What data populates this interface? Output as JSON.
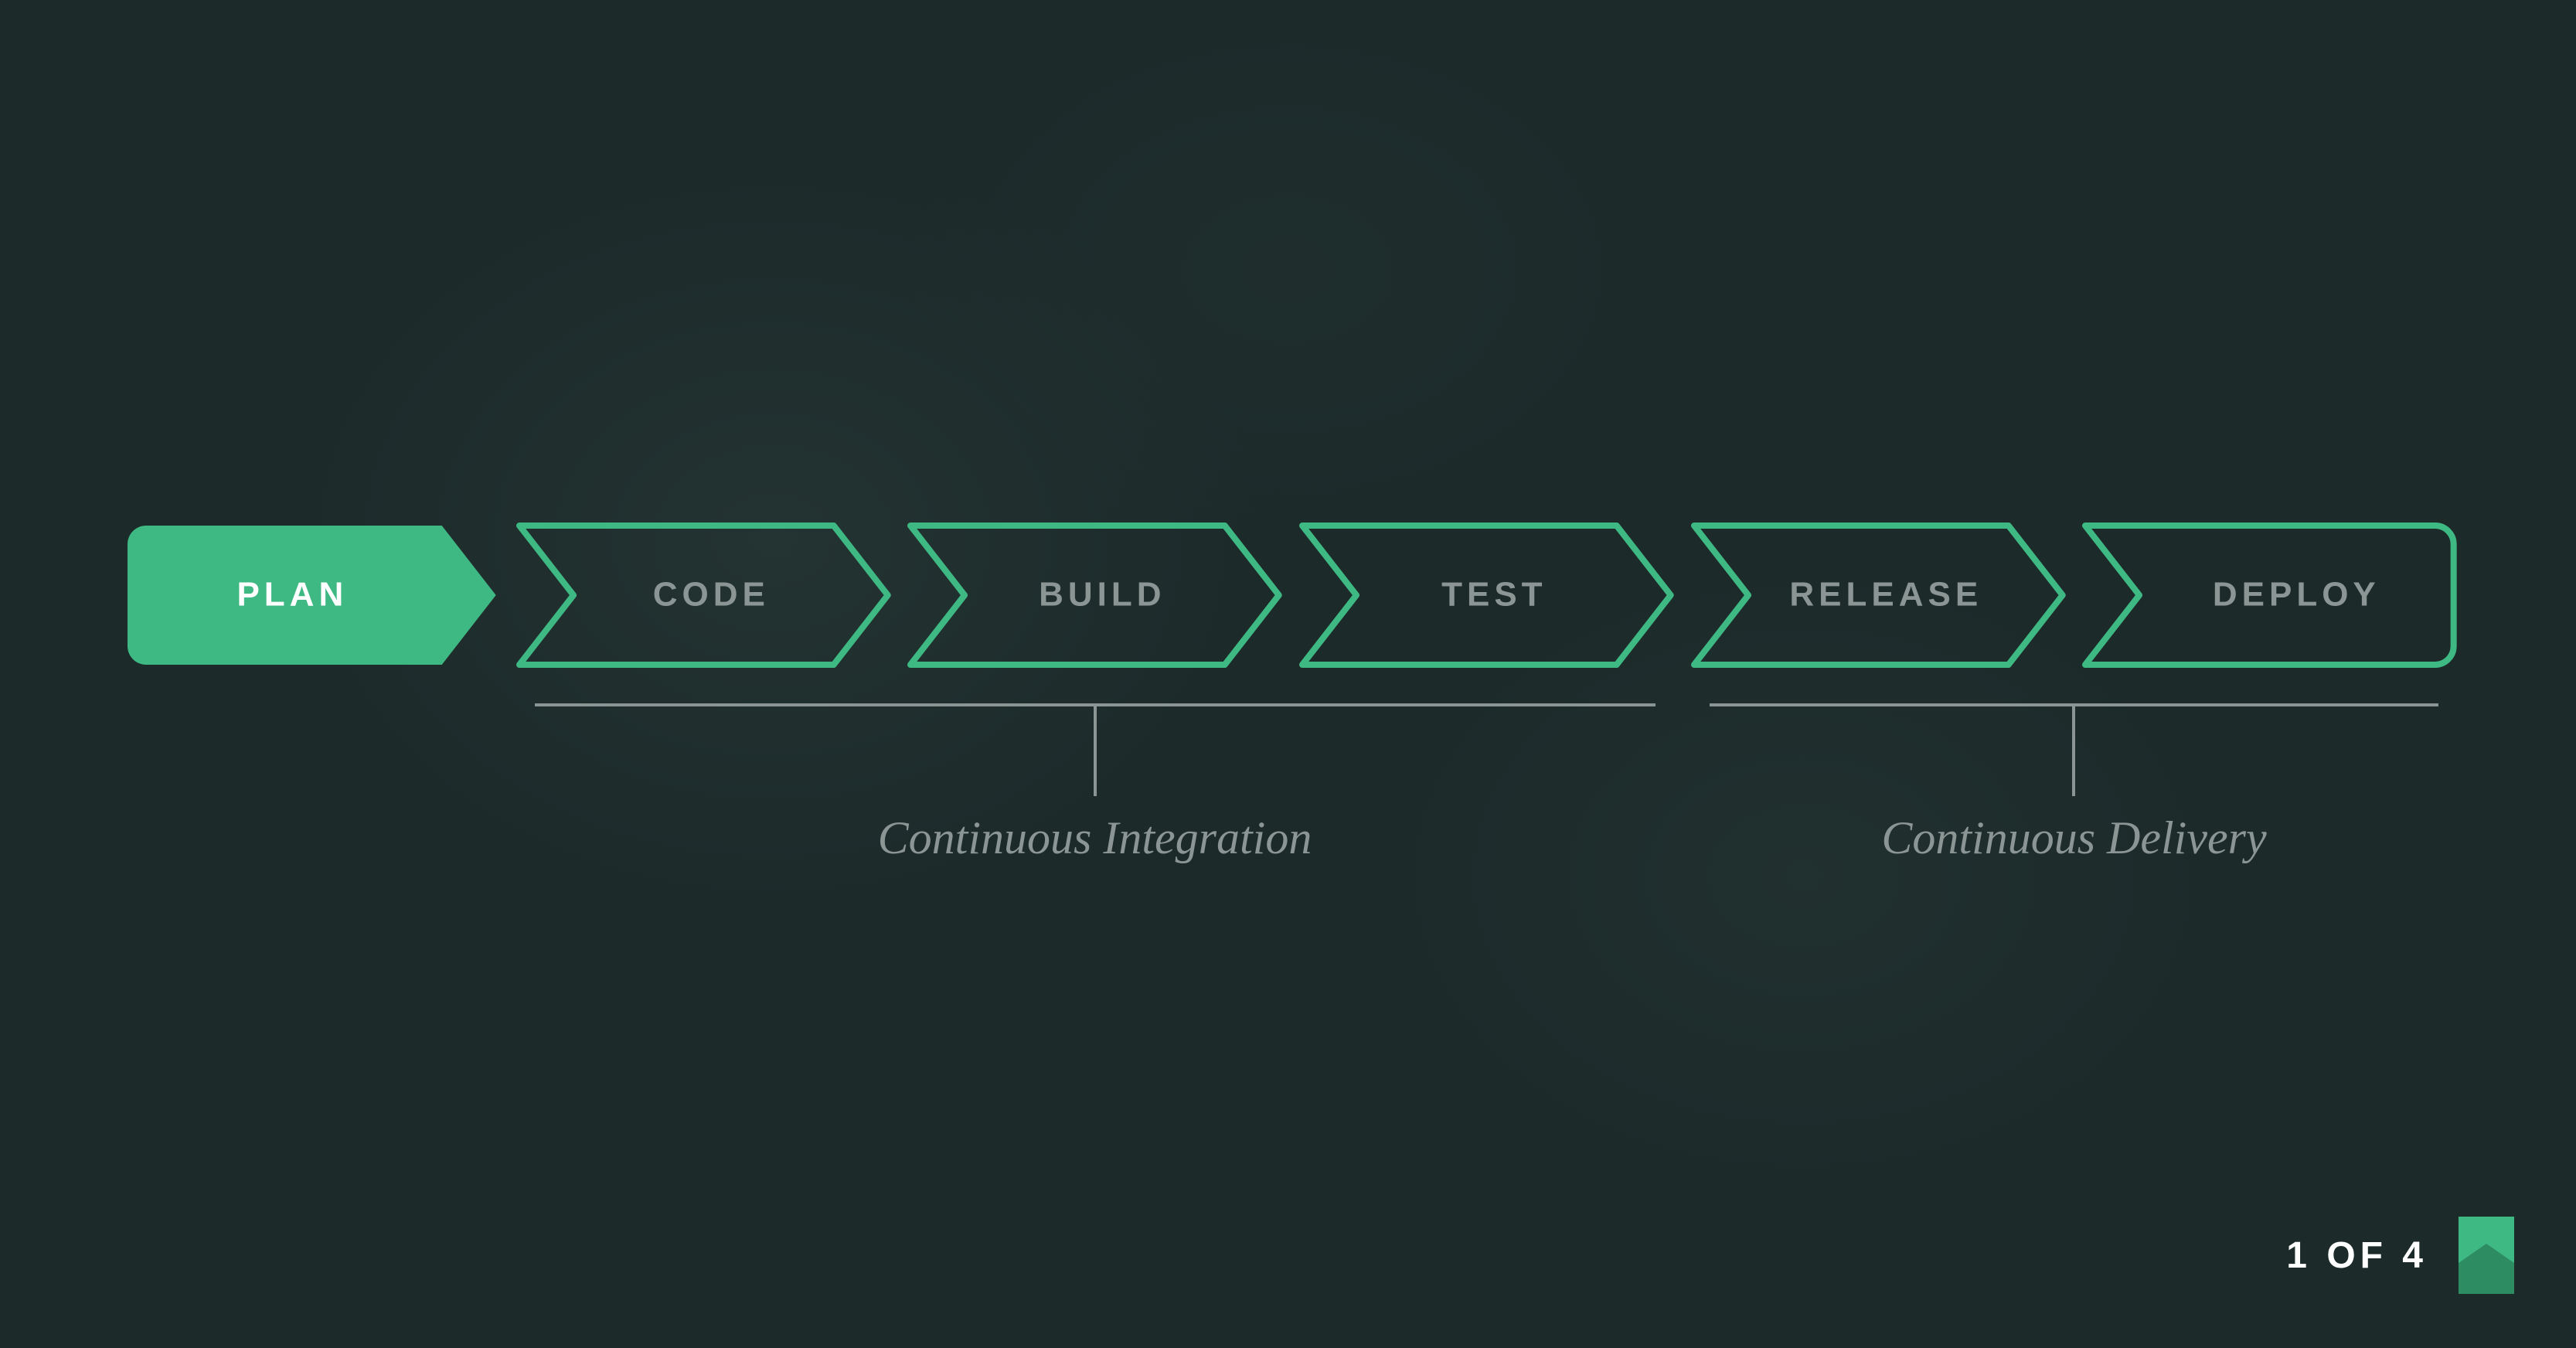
{
  "pipeline": {
    "stages": [
      {
        "label": "PLAN",
        "active": true
      },
      {
        "label": "CODE",
        "active": false
      },
      {
        "label": "BUILD",
        "active": false
      },
      {
        "label": "TEST",
        "active": false
      },
      {
        "label": "RELEASE",
        "active": false
      },
      {
        "label": "DEPLOY",
        "active": false
      }
    ],
    "groups": [
      {
        "label": "Continuous Integration",
        "from": 1,
        "to": 3
      },
      {
        "label": "Continuous Delivery",
        "from": 4,
        "to": 5
      }
    ]
  },
  "footer": {
    "page_label": "1 OF 4"
  },
  "colors": {
    "accent": "#3fb984",
    "background": "#1c2a2a"
  }
}
